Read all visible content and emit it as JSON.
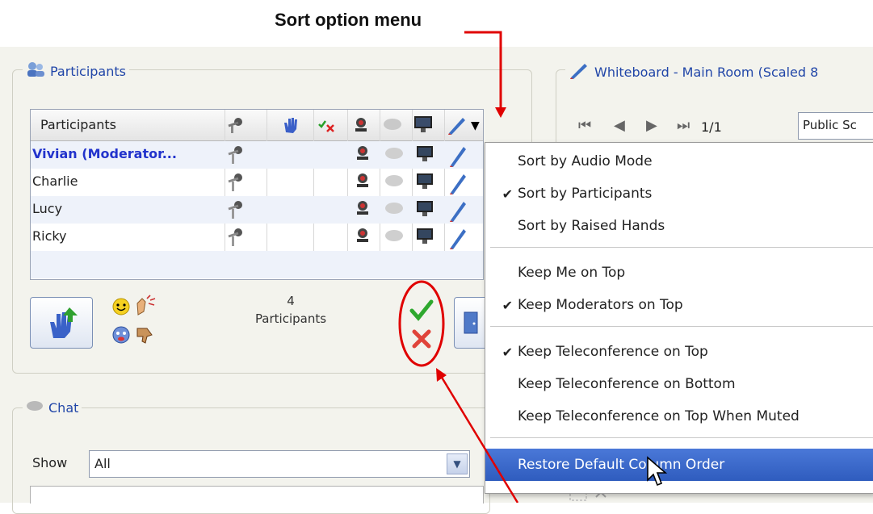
{
  "annotation": {
    "callout_label": "Sort option menu"
  },
  "participants_panel": {
    "title": "Participants",
    "column_header": "Participants",
    "rows": [
      {
        "name": "Vivian (Moderator..."
      },
      {
        "name": "Charlie"
      },
      {
        "name": "Lucy"
      },
      {
        "name": "Ricky"
      }
    ],
    "count": "4",
    "count_label": "Participants"
  },
  "whiteboard_panel": {
    "title": "Whiteboard - Main Room (Scaled 8",
    "page_indicator": "1/1",
    "scope_value": "Public Sc"
  },
  "chat_panel": {
    "title": "Chat",
    "show_label": "Show",
    "show_value": "All"
  },
  "sort_menu": {
    "items": [
      {
        "label": "Sort by Audio Mode",
        "checked": false
      },
      {
        "label": "Sort by Participants",
        "checked": true
      },
      {
        "label": "Sort by Raised Hands",
        "checked": false
      },
      {
        "label": "Keep Me on Top",
        "checked": false
      },
      {
        "label": "Keep Moderators on Top",
        "checked": true
      },
      {
        "label": "Keep Teleconference on Top",
        "checked": true
      },
      {
        "label": "Keep Teleconference on Bottom",
        "checked": false
      },
      {
        "label": "Keep Teleconference on Top When Muted",
        "checked": false
      },
      {
        "label": "Restore Default Column Order",
        "checked": false,
        "highlighted": true
      }
    ],
    "check_glyph": "✔"
  },
  "colors": {
    "accent": "#2146a8",
    "highlight": "#3a67c8",
    "annotation_red": "#e00000"
  }
}
